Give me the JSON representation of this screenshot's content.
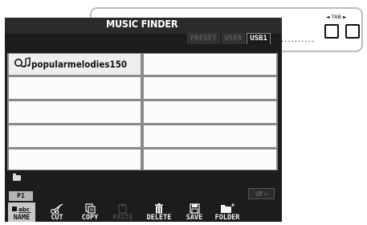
{
  "window": {
    "title": "MUSIC FINDER"
  },
  "tabs": [
    {
      "label": "PRESET",
      "active": false
    },
    {
      "label": "USER",
      "active": false
    },
    {
      "label": "USB1",
      "active": true
    }
  ],
  "annotation": {
    "dots": "..........",
    "tab_label": "TAB"
  },
  "file_list": {
    "items": [
      {
        "label": "popularmelodies150",
        "icon": "music-note-icon",
        "selected": true
      }
    ]
  },
  "folder_icon": "folder-icon",
  "page": {
    "label": "P1"
  },
  "up_button": {
    "label": "UP"
  },
  "functions": [
    {
      "key": "name",
      "label": "NAME",
      "icon": "abc-icon",
      "enabled": true
    },
    {
      "key": "cut",
      "label": "CUT",
      "icon": "scissors-icon",
      "enabled": true
    },
    {
      "key": "copy",
      "label": "COPY",
      "icon": "copy-icon",
      "enabled": true
    },
    {
      "key": "paste",
      "label": "PASTE",
      "icon": "paste-icon",
      "enabled": false
    },
    {
      "key": "delete",
      "label": "DELETE",
      "icon": "trash-icon",
      "enabled": true
    },
    {
      "key": "save",
      "label": "SAVE",
      "icon": "disk-icon",
      "enabled": true
    },
    {
      "key": "folder",
      "label": "FOLDER",
      "icon": "new-folder-icon",
      "enabled": true
    }
  ],
  "colors": {
    "screen_bg": "#1c1c1c",
    "cell_bg": "#fcfcfc",
    "grid_line": "#8a8a8a"
  }
}
